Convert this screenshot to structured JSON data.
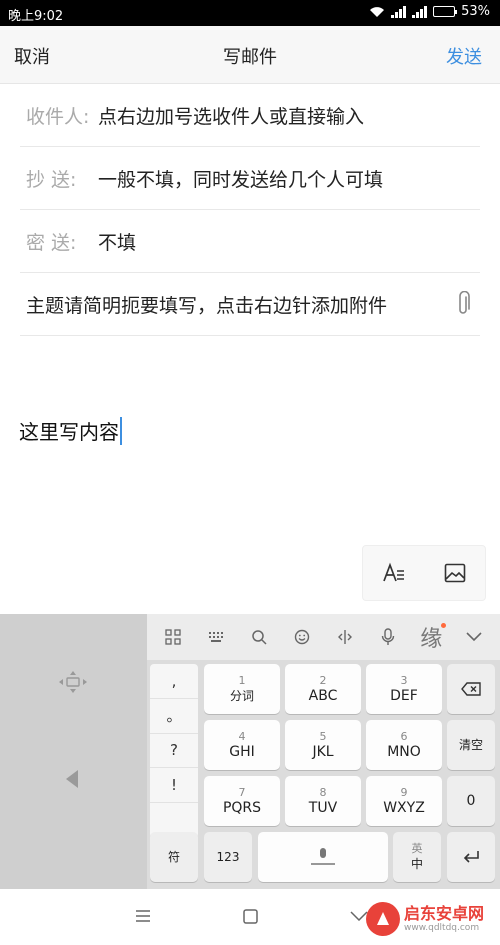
{
  "status_bar": {
    "time": "晚上9:02",
    "battery": "53%",
    "battery_level": 0.53
  },
  "header": {
    "cancel": "取消",
    "title": "写邮件",
    "send": "发送"
  },
  "form": {
    "to_label": "收件人:",
    "to_value": "点右边加号选收件人或直接输入",
    "cc_label": "抄 送:",
    "cc_value": "一般不填，同时发送给几个人可填",
    "bcc_label": "密 送:",
    "bcc_value": "不填",
    "subject_value": "主题请简明扼要填写，点击右边针添加附件",
    "attach_icon": "paperclip-icon"
  },
  "body": {
    "text": "这里写内容"
  },
  "format_bar": {
    "icons": [
      "text-format-icon",
      "image-icon"
    ]
  },
  "keyboard": {
    "toolbar_icons": [
      "grid-icon",
      "keyboard-icon",
      "search-icon",
      "emoji-icon",
      "cursor-icon",
      "mic-icon",
      "yuan-icon",
      "chevron-down-icon"
    ],
    "toolbar_yuan": "缘",
    "punct": [
      ",",
      "。",
      "?",
      "!"
    ],
    "keys": [
      {
        "num": "1",
        "label": "分词"
      },
      {
        "num": "2",
        "label": "ABC"
      },
      {
        "num": "3",
        "label": "DEF"
      },
      {
        "num": "4",
        "label": "GHI"
      },
      {
        "num": "5",
        "label": "JKL"
      },
      {
        "num": "6",
        "label": "MNO"
      },
      {
        "num": "7",
        "label": "PQRS"
      },
      {
        "num": "8",
        "label": "TUV"
      },
      {
        "num": "9",
        "label": "WXYZ"
      }
    ],
    "clear": "清空",
    "zero": "0",
    "symbol": "符",
    "num123": "123",
    "lang_top": "英",
    "lang_bottom": "中"
  },
  "watermark": {
    "name": "启东安卓网",
    "url": "www.qdltdq.com"
  }
}
